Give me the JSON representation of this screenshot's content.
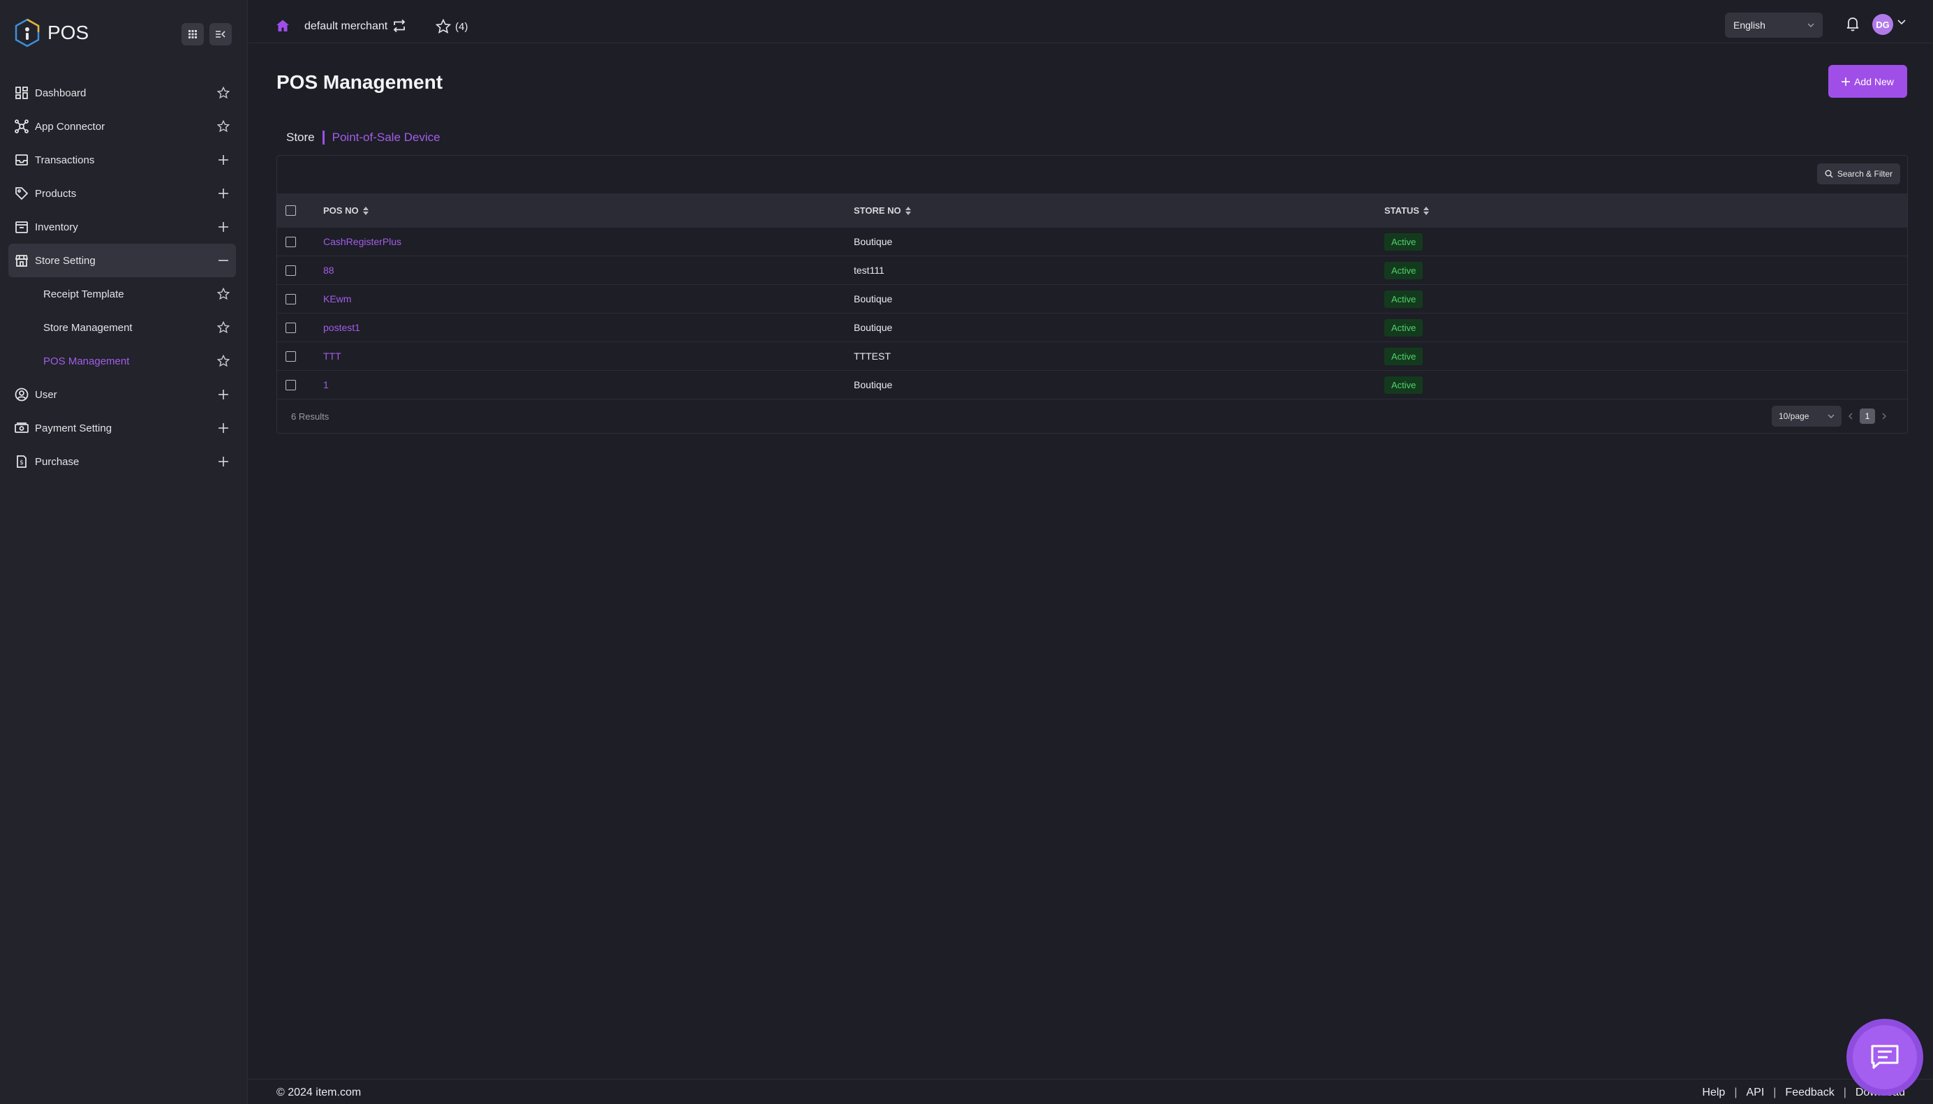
{
  "app": {
    "name": "POS"
  },
  "sidebar": {
    "items": [
      {
        "label": "Dashboard",
        "icon": "dashboard-icon",
        "right": "star"
      },
      {
        "label": "App Connector",
        "icon": "app-connector-icon",
        "right": "star"
      },
      {
        "label": "Transactions",
        "icon": "transactions-icon",
        "right": "plus"
      },
      {
        "label": "Products",
        "icon": "products-icon",
        "right": "plus"
      },
      {
        "label": "Inventory",
        "icon": "inventory-icon",
        "right": "plus"
      },
      {
        "label": "Store Setting",
        "icon": "store-icon",
        "right": "minus",
        "active": true
      },
      {
        "label": "Receipt Template",
        "sub": true,
        "right": "star"
      },
      {
        "label": "Store Management",
        "sub": true,
        "right": "star"
      },
      {
        "label": "POS Management",
        "sub": true,
        "right": "star",
        "current": true
      },
      {
        "label": "User",
        "icon": "user-icon",
        "right": "plus"
      },
      {
        "label": "Payment Setting",
        "icon": "payment-icon",
        "right": "plus"
      },
      {
        "label": "Purchase",
        "icon": "purchase-icon",
        "right": "plus"
      }
    ]
  },
  "header": {
    "merchant": "default merchant",
    "favorites_count": "(4)",
    "language": "English",
    "avatar_initials": "DG"
  },
  "page": {
    "title": "POS Management",
    "add_button": "Add New",
    "breadcrumb": {
      "parent": "Store",
      "current": "Point-of-Sale Device"
    }
  },
  "table": {
    "search_button": "Search & Filter",
    "columns": [
      "POS NO",
      "STORE NO",
      "STATUS"
    ],
    "rows": [
      {
        "pos": "CashRegisterPlus",
        "store": "Boutique",
        "status": "Active"
      },
      {
        "pos": "88",
        "store": "test111",
        "status": "Active"
      },
      {
        "pos": "KEwm",
        "store": "Boutique",
        "status": "Active"
      },
      {
        "pos": "postest1",
        "store": "Boutique",
        "status": "Active"
      },
      {
        "pos": "TTT",
        "store": "TTTEST",
        "status": "Active"
      },
      {
        "pos": "1",
        "store": "Boutique",
        "status": "Active"
      }
    ],
    "results": "6 Results",
    "per_page": "10/page",
    "current_page": "1"
  },
  "footer": {
    "copyright": "© 2024 item.com",
    "links": [
      "Help",
      "API",
      "Feedback",
      "Download"
    ]
  },
  "colors": {
    "accent": "#a04ee8",
    "background": "#1d1e26",
    "sidebar": "#22232b",
    "active_badge": "#4fd16b"
  }
}
